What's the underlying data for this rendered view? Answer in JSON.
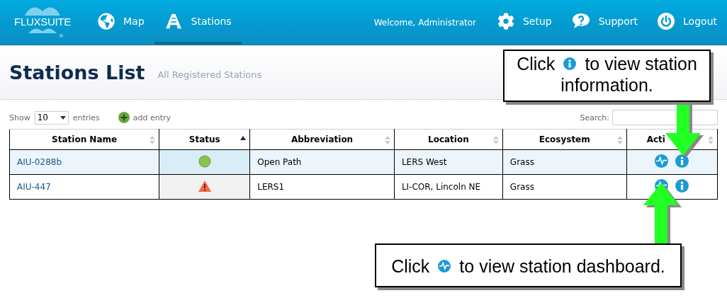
{
  "nav": {
    "logo": "FLUXSUITE",
    "registered": "®",
    "items": [
      {
        "label": "Map",
        "selected": false
      },
      {
        "label": "Stations",
        "selected": true
      }
    ],
    "welcome": "Welcome, Administrator",
    "right_items": [
      {
        "label": "Setup"
      },
      {
        "label": "Support"
      },
      {
        "label": "Logout"
      }
    ]
  },
  "header": {
    "title": "Stations List",
    "subtitle": "All Registered Stations"
  },
  "controls": {
    "show_label": "Show",
    "page_size": "10",
    "entries_label": "entries",
    "add_entry": "add entry",
    "search_label": "Search:"
  },
  "table": {
    "columns": [
      {
        "label": "Station Name",
        "sorted": false
      },
      {
        "label": "Status",
        "sorted": true
      },
      {
        "label": "Abbreviation",
        "sorted": false
      },
      {
        "label": "Location",
        "sorted": false
      },
      {
        "label": "Ecosystem",
        "sorted": false
      },
      {
        "label": "Acti",
        "sorted": false
      }
    ],
    "rows": [
      {
        "station_name": "AIU-0288b",
        "kind": "ok",
        "abbreviation": "Open Path",
        "location": "LERS West",
        "ecosystem": "Grass",
        "selected": true
      },
      {
        "station_name": "AIU-447",
        "kind": "warning",
        "abbreviation": "LERS1",
        "location": "LI-COR, Lincoln NE",
        "ecosystem": "Grass",
        "selected": false
      }
    ]
  },
  "callouts": [
    {
      "before": "Click",
      "lines": [
        "to view station",
        "information."
      ]
    },
    {
      "before": "Click",
      "lines": [
        "to view station dashboard."
      ]
    }
  ]
}
